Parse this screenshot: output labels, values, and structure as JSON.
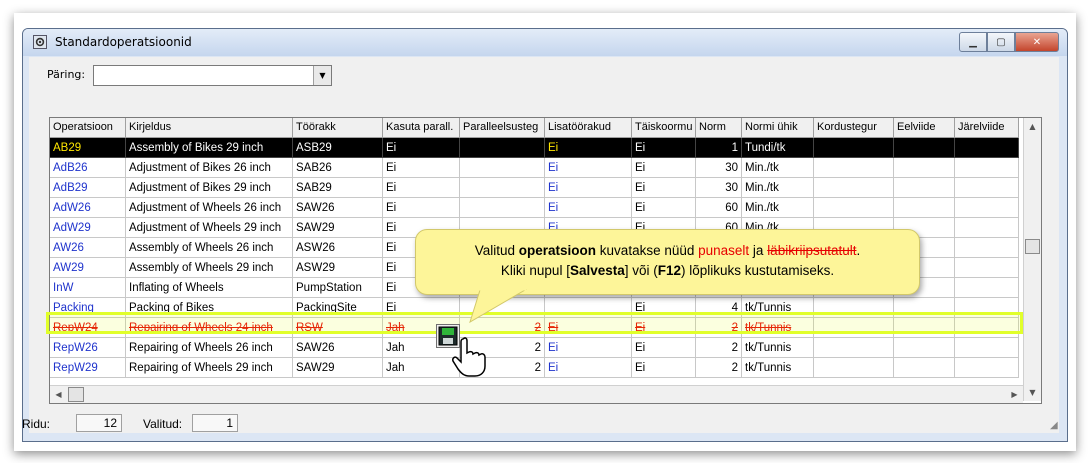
{
  "window": {
    "title": "Standardoperatsioonid",
    "controls": [
      "minimize-icon",
      "maximize-icon",
      "close-icon"
    ]
  },
  "query": {
    "label": "Päring:",
    "value": ""
  },
  "table": {
    "columns": [
      "Operatsioon",
      "Kirjeldus",
      "Töörakk",
      "Kasuta parall.",
      "Paralleelsusteg",
      "Lisatöörakud",
      "Täiskoormu",
      "Norm",
      "Normi ühik",
      "Kordustegur",
      "Eelviide",
      "Järelviide"
    ],
    "rows": [
      {
        "op": "AB29",
        "desc": "Assembly of Bikes 29 inch",
        "cell": "ASB29",
        "par": "Ei",
        "pardeg": "",
        "extra": "Ei",
        "full": "Ei",
        "norm": "1",
        "unit": "Tundi/tk",
        "rep": "",
        "pre": "",
        "post": ""
      },
      {
        "op": "AdB26",
        "desc": "Adjustment of Bikes 26 inch",
        "cell": "SAB26",
        "par": "Ei",
        "pardeg": "",
        "extra": "Ei",
        "full": "Ei",
        "norm": "30",
        "unit": "Min./tk",
        "rep": "",
        "pre": "",
        "post": ""
      },
      {
        "op": "AdB29",
        "desc": "Adjustment of Bikes 29 inch",
        "cell": "SAB29",
        "par": "Ei",
        "pardeg": "",
        "extra": "Ei",
        "full": "Ei",
        "norm": "30",
        "unit": "Min./tk",
        "rep": "",
        "pre": "",
        "post": ""
      },
      {
        "op": "AdW26",
        "desc": "Adjustment of Wheels 26 inch",
        "cell": "SAW26",
        "par": "Ei",
        "pardeg": "",
        "extra": "Ei",
        "full": "Ei",
        "norm": "60",
        "unit": "Min./tk",
        "rep": "",
        "pre": "",
        "post": ""
      },
      {
        "op": "AdW29",
        "desc": "Adjustment of Wheels 29 inch",
        "cell": "SAW29",
        "par": "Ei",
        "pardeg": "",
        "extra": "Ei",
        "full": "Ei",
        "norm": "60",
        "unit": "Min./tk",
        "rep": "",
        "pre": "",
        "post": ""
      },
      {
        "op": "AW26",
        "desc": "Assembly of Wheels 26 inch",
        "cell": "ASW26",
        "par": "Ei",
        "pardeg": "",
        "extra": "",
        "full": "",
        "norm": "",
        "unit": "",
        "rep": "",
        "pre": "",
        "post": ""
      },
      {
        "op": "AW29",
        "desc": "Assembly of Wheels 29 inch",
        "cell": "ASW29",
        "par": "Ei",
        "pardeg": "",
        "extra": "",
        "full": "",
        "norm": "",
        "unit": "",
        "rep": "",
        "pre": "",
        "post": ""
      },
      {
        "op": "InW",
        "desc": "Inflating of Wheels",
        "cell": "PumpStation",
        "par": "Ei",
        "pardeg": "",
        "extra": "",
        "full": "",
        "norm": "",
        "unit": "",
        "rep": "",
        "pre": "",
        "post": ""
      },
      {
        "op": "Packing",
        "desc": "Packing of Bikes",
        "cell": "PackingSite",
        "par": "Ei",
        "pardeg": "",
        "extra": "",
        "full": "Ei",
        "norm": "4",
        "unit": "tk/Tunnis",
        "rep": "",
        "pre": "",
        "post": ""
      },
      {
        "op": "RepW24",
        "desc": "Repairing of Wheels 24 inch",
        "cell": "RSW",
        "par": "Jah",
        "pardeg": "2",
        "extra": "Ei",
        "full": "Ei",
        "norm": "2",
        "unit": "tk/Tunnis",
        "rep": "",
        "pre": "",
        "post": ""
      },
      {
        "op": "RepW26",
        "desc": "Repairing of Wheels 26 inch",
        "cell": "SAW26",
        "par": "Jah",
        "pardeg": "2",
        "extra": "Ei",
        "full": "Ei",
        "norm": "2",
        "unit": "tk/Tunnis",
        "rep": "",
        "pre": "",
        "post": ""
      },
      {
        "op": "RepW29",
        "desc": "Repairing of Wheels 29 inch",
        "cell": "SAW29",
        "par": "Jah",
        "pardeg": "2",
        "extra": "Ei",
        "full": "Ei",
        "norm": "2",
        "unit": "tk/Tunnis",
        "rep": "",
        "pre": "",
        "post": ""
      }
    ],
    "selected_index": 0,
    "deleted_index": 9
  },
  "callout": {
    "line1_a": "Valitud ",
    "line1_b": "operatsioon",
    "line1_c": " kuvatakse nüüd ",
    "line1_d": "punaselt",
    "line1_e": " ja ",
    "line1_f": "läbikriipsutatult",
    "line1_g": ".",
    "line2_a": "Kliki nupul  [",
    "line2_b": "Salvesta",
    "line2_c": "] või (",
    "line2_d": "F12",
    "line2_e": ") lõplikuks kustutamiseks."
  },
  "status": {
    "rows_label": "Ridu:",
    "rows_value": "12",
    "selected_label": "Valitud:",
    "selected_value": "1"
  },
  "colors": {
    "link_blue": "#1f33cc",
    "deleted_red": "#e60000",
    "selected_yellow": "#ffe600",
    "highlight": "#e1ff2a",
    "callout_bg": "#fdf599"
  }
}
